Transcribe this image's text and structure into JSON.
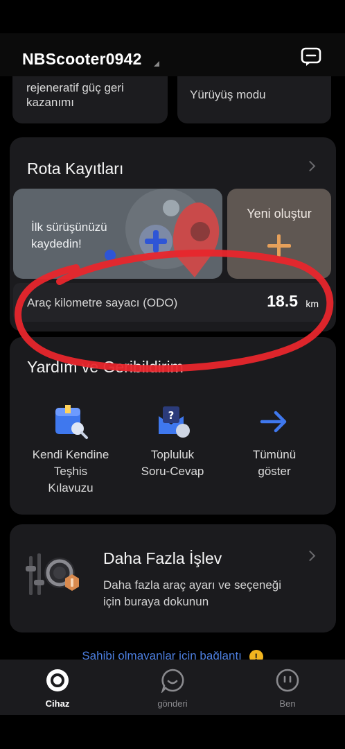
{
  "header": {
    "device_name": "NBScooter0942"
  },
  "top_cards": [
    {
      "label": "rejeneratif güç geri\nkazanımı"
    },
    {
      "label": "Yürüyüş modu"
    }
  ],
  "route_records": {
    "title": "Rota Kayıtları",
    "first_ride": "İlk sürüşünüzü\nkaydedin!",
    "create_new": "Yeni oluştur",
    "odo_label": "Araç kilometre sayacı (ODO)",
    "odo_value": "18.5",
    "odo_unit": "km"
  },
  "help": {
    "title": "Yardım ve Geribildirim",
    "items": [
      {
        "label": "Kendi Kendine\nTeşhis\nKılavuzu",
        "icon": "diagnosis-guide-icon"
      },
      {
        "label": "Topluluk\nSoru-Cevap",
        "icon": "community-qa-icon"
      },
      {
        "label": "Tümünü\ngöster",
        "icon": "arrow-right-icon"
      }
    ]
  },
  "more": {
    "title": "Daha Fazla İşlev",
    "description": "Daha fazla araç ayarı ve seçeneği\niçin buraya dokunun"
  },
  "link_peek": "Sahibi olmayanlar için bağlantı",
  "nav": {
    "items": [
      {
        "label": "Cihaz",
        "active": true
      },
      {
        "label": "gönderi",
        "active": false
      },
      {
        "label": "Ben",
        "active": false
      }
    ]
  },
  "colors": {
    "background": "#000000",
    "card": "#1b1b1e",
    "accent_orange": "#e6a05a",
    "link_blue": "#4d7fe0",
    "annotation_red": "#e8262c"
  }
}
